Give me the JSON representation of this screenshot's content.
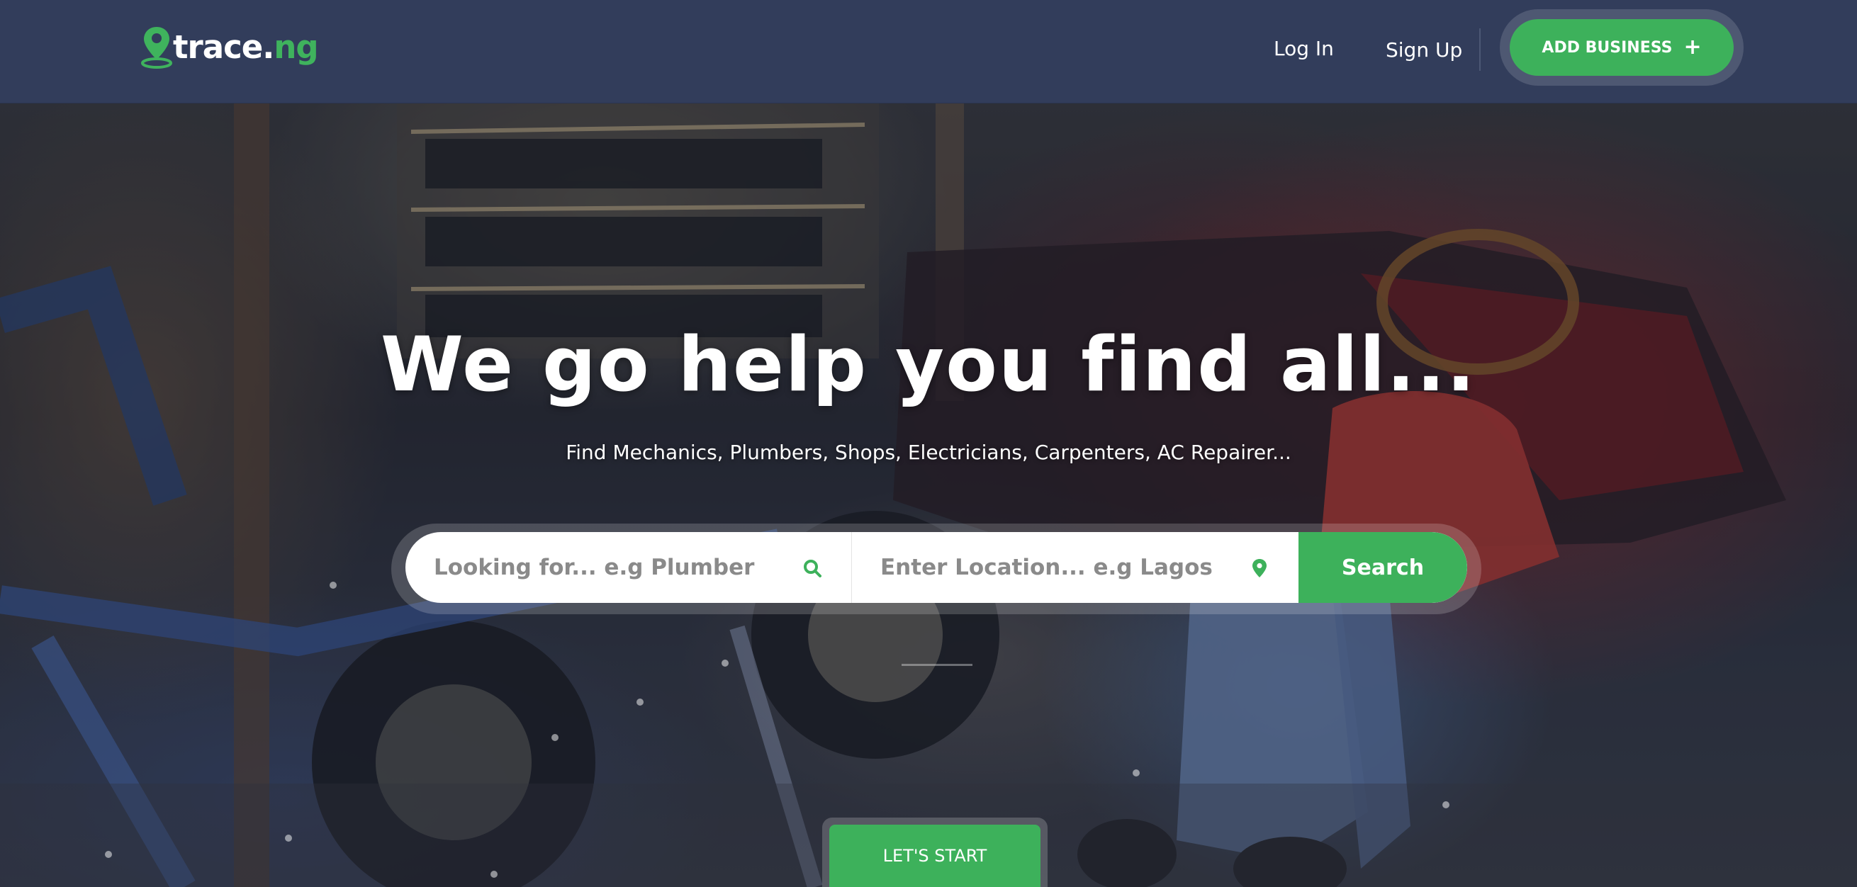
{
  "header": {
    "logo": {
      "main": "trace.",
      "tld": "ng"
    },
    "nav": {
      "login": "Log In",
      "signup": "Sign Up"
    },
    "add_business": {
      "label": "ADD BUSINESS",
      "icon": "plus-icon"
    }
  },
  "hero": {
    "title": "We go help you find all...",
    "subtitle": "Find Mechanics, Plumbers, Shops, Electricians, Carpenters, AC Repairer...",
    "search": {
      "what_placeholder": "Looking for... e.g Plumber",
      "what_icon": "search-icon",
      "where_placeholder": "Enter Location... e.g Lagos",
      "where_icon": "location-pin-icon",
      "button_label": "Search"
    },
    "cta_label": "LET'S START",
    "background_image": "mechanic working on a car in a garage"
  },
  "colors": {
    "header_bg": "#323d5b",
    "accent_green": "#3db15b",
    "text_white": "#ffffff"
  }
}
